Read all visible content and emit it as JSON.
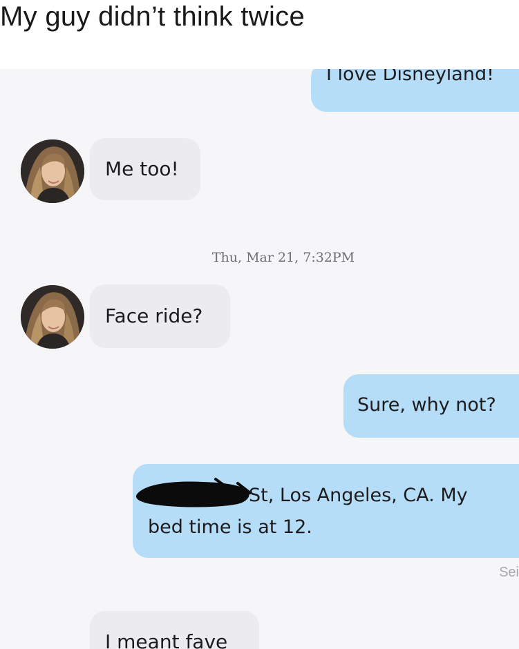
{
  "caption": "My guy didn’t think twice",
  "thread": {
    "messages": [
      {
        "id": "m1",
        "direction": "sent",
        "text": "I love Disneyland!"
      },
      {
        "id": "m2",
        "direction": "received",
        "text": "Me too!"
      },
      {
        "id": "m4",
        "direction": "received",
        "text": "Face ride?"
      },
      {
        "id": "m5",
        "direction": "sent",
        "text": "Sure, why not?"
      },
      {
        "id": "m6",
        "direction": "sent",
        "line1": "St, Los Angeles, CA. My",
        "line2": "bed time is at 12."
      },
      {
        "id": "m7",
        "direction": "received",
        "text": "I meant fave"
      }
    ],
    "timestamp": "Thu, Mar 21, 7:32PM",
    "status_partial": "Sei"
  },
  "colors": {
    "sent_bubble": "#b6ddf8",
    "received_bubble": "#ececef",
    "chat_background": "#f6f6f8",
    "timestamp_text": "#6e6e73"
  },
  "icons": {
    "avatar": "contact-avatar-photo",
    "redaction": "scribble-redaction-mark"
  }
}
